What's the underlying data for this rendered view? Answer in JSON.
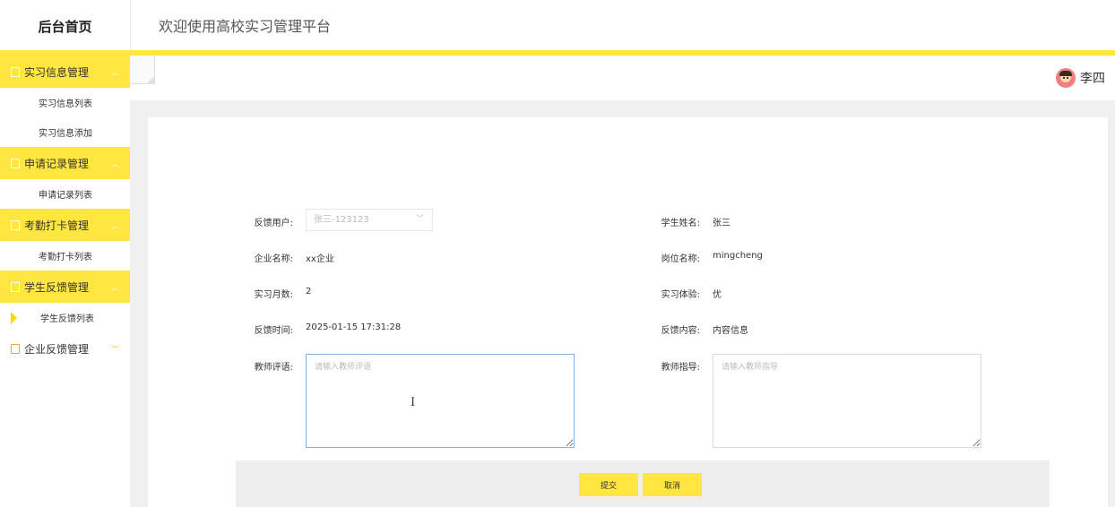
{
  "header": {
    "logo": "后台首页",
    "title": "欢迎使用高校实习管理平台"
  },
  "user": {
    "name": "李四"
  },
  "sidebar": {
    "groups": [
      {
        "label": "实习信息管理",
        "items": [
          "实习信息列表",
          "实习信息添加"
        ]
      },
      {
        "label": "申请记录管理",
        "items": [
          "申请记录列表"
        ]
      },
      {
        "label": "考勤打卡管理",
        "items": [
          "考勤打卡列表"
        ]
      },
      {
        "label": "学生反馈管理",
        "items": [
          "学生反馈列表"
        ]
      },
      {
        "label": "企业反馈管理",
        "items": []
      }
    ],
    "active_item": "学生反馈列表"
  },
  "form": {
    "feedback_user": {
      "label": "反馈用户:",
      "value": "张三-123123"
    },
    "student_name": {
      "label": "学生姓名:",
      "value": "张三"
    },
    "company_name": {
      "label": "企业名称:",
      "value": "xx企业"
    },
    "position_name": {
      "label": "岗位名称:",
      "value": "mingcheng"
    },
    "months": {
      "label": "实习月数:",
      "value": "2"
    },
    "experience": {
      "label": "实习体验:",
      "value": "优"
    },
    "feedback_time": {
      "label": "反馈时间:",
      "value": "2025-01-15 17:31:28"
    },
    "feedback_content": {
      "label": "反馈内容:",
      "value": "内容信息"
    },
    "teacher_comment": {
      "label": "教师评语:",
      "placeholder": "请输入教师评语"
    },
    "teacher_guidance": {
      "label": "教师指导:",
      "placeholder": "请输入教师指导"
    }
  },
  "buttons": {
    "submit": "提交",
    "cancel": "取消"
  },
  "colors": {
    "accent": "#ffe640",
    "focus_border": "#7fb2e6"
  }
}
